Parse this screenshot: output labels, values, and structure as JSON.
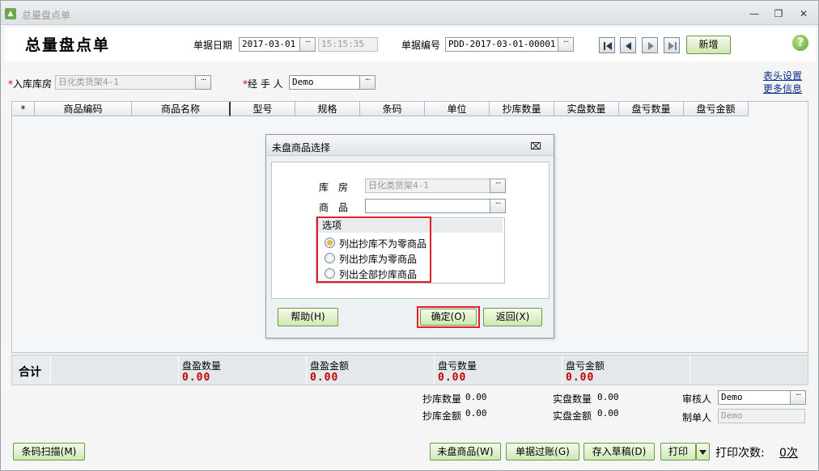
{
  "window": {
    "title": "总量盘点单",
    "form_title": "总量盘点单"
  },
  "header": {
    "date_label": "单据日期",
    "date_value": "2017-03-01",
    "time_value": "15:15:35",
    "docno_label": "单据编号",
    "docno_value": "PDD-2017-03-01-00001",
    "new_button": "新增",
    "warehouse_label": "入库库房",
    "warehouse_value": "日化类货架4-1",
    "handler_label": "经 手 人",
    "handler_value": "Demo",
    "header_settings_link": "表头设置",
    "more_info_link": "更多信息"
  },
  "grid": {
    "columns": [
      "*",
      "商品编码",
      "商品名称",
      "型号",
      "规格",
      "条码",
      "单位",
      "抄库数量",
      "实盘数量",
      "盘亏数量",
      "盘亏金额"
    ]
  },
  "summary": {
    "total_label": "合计",
    "cells": [
      {
        "label": "盘盈数量",
        "value": "0.00"
      },
      {
        "label": "盘盈金额",
        "value": "0.00"
      },
      {
        "label": "盘亏数量",
        "value": "0.00"
      },
      {
        "label": "盘亏金额",
        "value": "0.00"
      }
    ]
  },
  "footer_info": {
    "copy_qty_label": "抄库数量",
    "copy_qty_value": "0.00",
    "copy_amt_label": "抄库金额",
    "copy_amt_value": "0.00",
    "actual_qty_label": "实盘数量",
    "actual_qty_value": "0.00",
    "actual_amt_label": "实盘金额",
    "actual_amt_value": "0.00",
    "auditor_label": "审核人",
    "auditor_value": "Demo",
    "maker_label": "制单人",
    "maker_value": "Demo"
  },
  "bottom": {
    "barcode_btn": "条码扫描(M)",
    "uncounted_btn": "未盘商品(W)",
    "post_btn": "单据过账(G)",
    "draft_btn": "存入草稿(D)",
    "print_btn": "打印",
    "print_count_label": "打印次数:",
    "print_count_value": "0次"
  },
  "dialog": {
    "title": "未盘商品选择",
    "warehouse_label": "库　房",
    "warehouse_value": "日化类货架4-1",
    "product_label": "商　品",
    "product_value": "",
    "options_legend": "选项",
    "options": [
      {
        "label": "列出抄库不为零商品",
        "checked": true
      },
      {
        "label": "列出抄库为零商品",
        "checked": false
      },
      {
        "label": "列出全部抄库商品",
        "checked": false
      }
    ],
    "help_btn": "帮助(H)",
    "ok_btn": "确定(O)",
    "back_btn": "返回(X)"
  },
  "colors": {
    "accent_green": "#cfe8b3",
    "highlight_red": "#e21e26",
    "value_red": "#c00000"
  }
}
